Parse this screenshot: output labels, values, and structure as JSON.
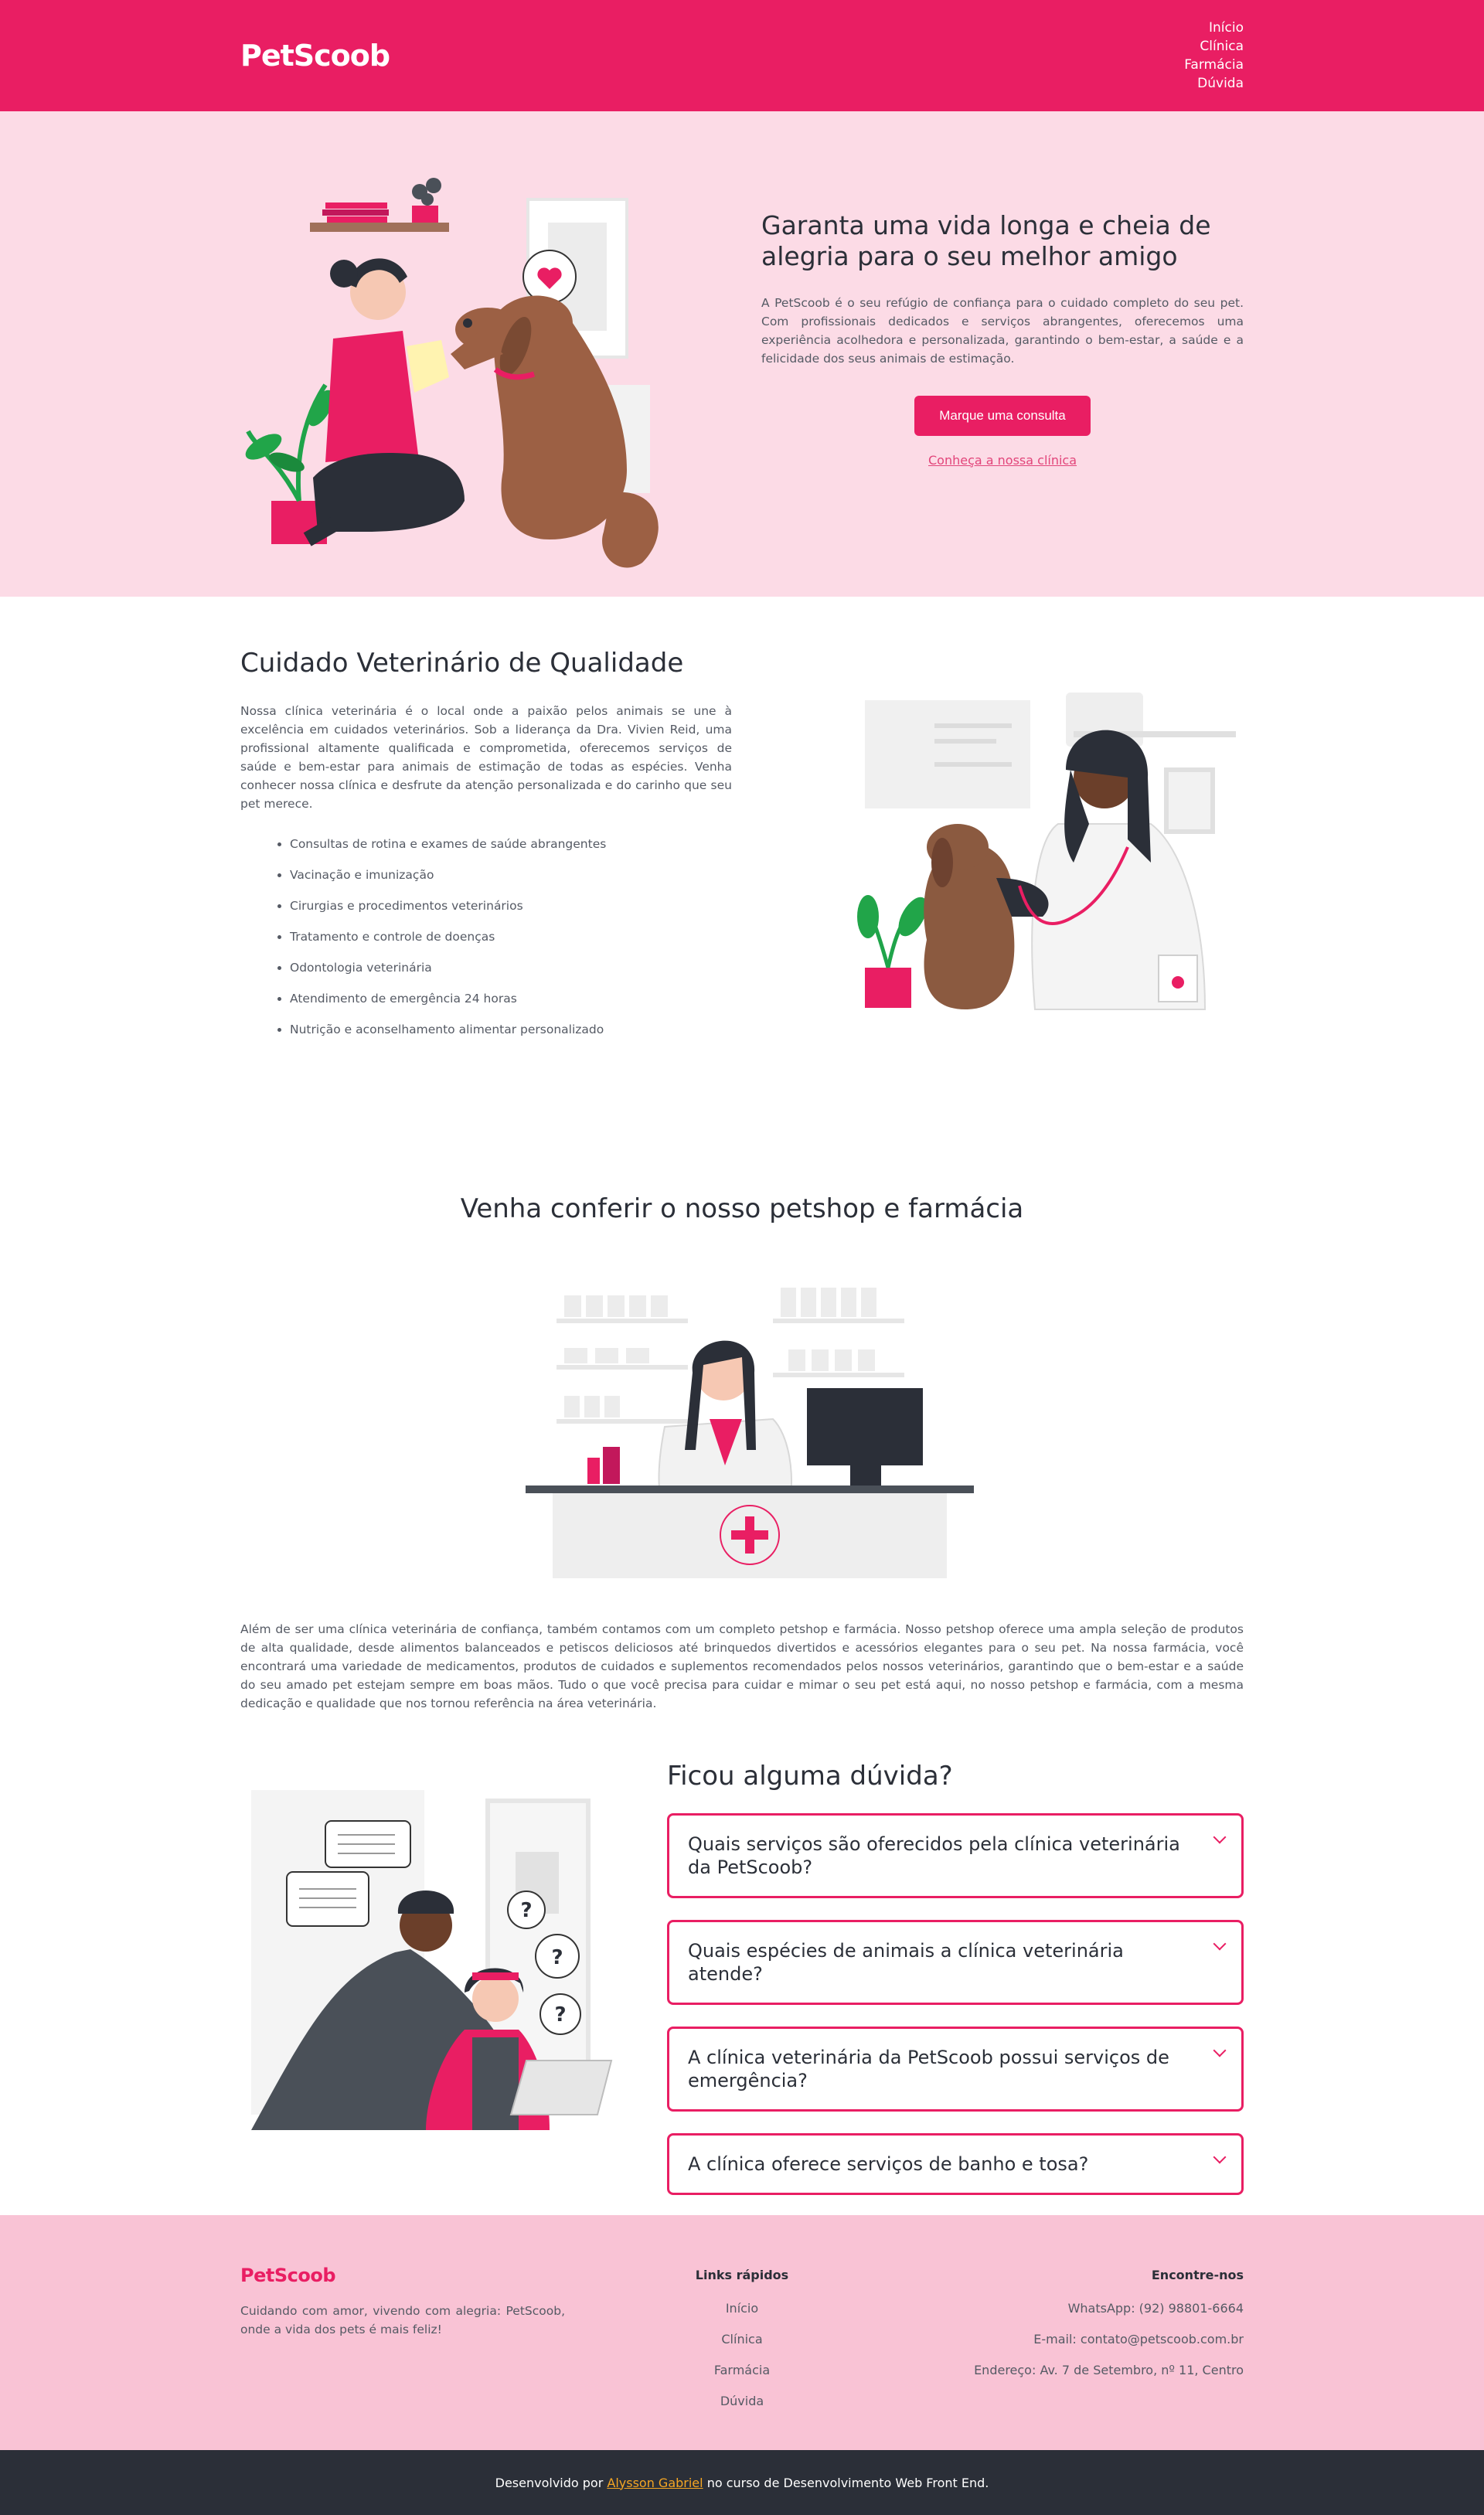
{
  "header": {
    "logo": "PetScoob",
    "nav": [
      "Início",
      "Clínica",
      "Farmácia",
      "Dúvida"
    ]
  },
  "hero": {
    "title": "Garanta uma vida longa e cheia de alegria para o seu melhor amigo",
    "text": "A PetScoob é o seu refúgio de confiança para o cuidado completo do seu pet. Com profissionais dedicados e serviços abrangentes, oferecemos uma experiência acolhedora e personalizada, garantindo o bem-estar, a saúde e a felicidade dos seus animais de estimação.",
    "cta_label": "Marque uma consulta",
    "link_label": "Conheça a nossa clínica"
  },
  "care": {
    "title": "Cuidado Veterinário de Qualidade",
    "text": "Nossa clínica veterinária é o local onde a paixão pelos animais se une à excelência em cuidados veterinários. Sob a liderança da Dra. Vivien Reid, uma profissional altamente qualificada e comprometida, oferecemos serviços de saúde e bem-estar para animais de estimação de todas as espécies. Venha conhecer nossa clínica e desfrute da atenção personalizada e do carinho que seu pet merece.",
    "services": [
      "Consultas de rotina e exames de saúde abrangentes",
      "Vacinação e imunização",
      "Cirurgias e procedimentos veterinários",
      "Tratamento e controle de doenças",
      "Odontologia veterinária",
      "Atendimento de emergência 24 horas",
      "Nutrição e aconselhamento alimentar personalizado"
    ]
  },
  "petshop": {
    "title": "Venha conferir o nosso petshop e farmácia",
    "text": "Além de ser uma clínica veterinária de confiança, também contamos com um completo petshop e farmácia. Nosso petshop oferece uma ampla seleção de produtos de alta qualidade, desde alimentos balanceados e petiscos deliciosos até brinquedos divertidos e acessórios elegantes para o seu pet. Na nossa farmácia, você encontrará uma variedade de medicamentos, produtos de cuidados e suplementos recomendados pelos nossos veterinários, garantindo que o bem-estar e a saúde do seu amado pet estejam sempre em boas mãos. Tudo o que você precisa para cuidar e mimar o seu pet está aqui, no nosso petshop e farmácia, com a mesma dedicação e qualidade que nos tornou referência na área veterinária."
  },
  "faq": {
    "title": "Ficou alguma dúvida?",
    "questions": [
      "Quais serviços são oferecidos pela clínica veterinária da PetScoob?",
      "Quais espécies de animais a clínica veterinária atende?",
      "A clínica veterinária da PetScoob possui serviços de emergência?",
      "A clínica oferece serviços de banho e tosa?"
    ]
  },
  "footer": {
    "logo": "PetScoob",
    "tagline": "Cuidando com amor, vivendo com alegria: PetScoob, onde a vida dos pets é mais feliz!",
    "links_title": "Links rápidos",
    "links": [
      "Início",
      "Clínica",
      "Farmácia",
      "Dúvida"
    ],
    "contact_title": "Encontre-nos",
    "contact": [
      "WhatsApp: (92) 98801-6664",
      "E-mail: contato@petscoob.com.br",
      "Endereço: Av. 7 de Setembro, nº 11, Centro"
    ],
    "credit_prefix": "Desenvolvido por",
    "credit_author": "Alysson Gabriel",
    "credit_suffix": "no curso de Desenvolvimento Web Front End."
  },
  "colors": {
    "brand": "#e91e63",
    "hero_bg": "#fcdbe6",
    "footer_bg": "#f9c3d5",
    "bottom_bar": "#2b2f38",
    "credit_link": "#f5a623"
  }
}
